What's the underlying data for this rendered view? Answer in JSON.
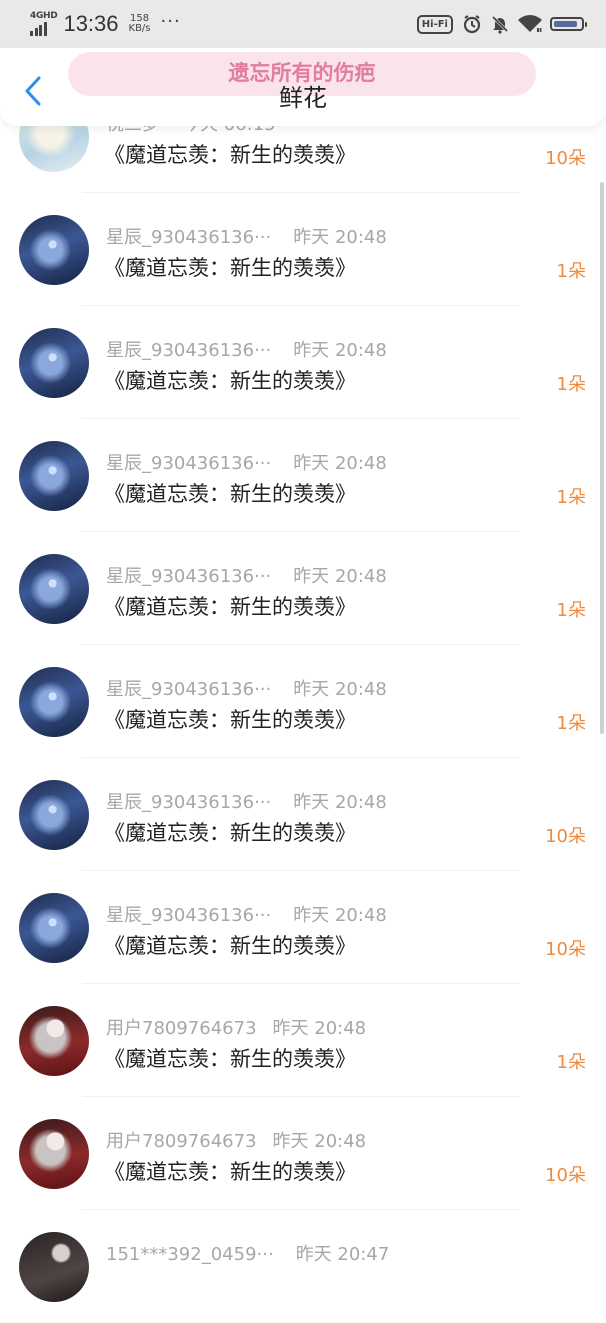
{
  "status_bar": {
    "network": "4GHD",
    "time": "13:36",
    "speed_value": "158",
    "speed_unit": "KB/s",
    "more": "···",
    "hifi": "Hi-Fi",
    "battery_level": 0.9
  },
  "header": {
    "title": "鲜花",
    "back_icon": "chevron-left-icon",
    "banner_text": "遗忘所有的伤疤"
  },
  "colors": {
    "accent_blue": "#2c8ef0",
    "amount_orange": "#f08a3c",
    "banner_pink": "#e27ca0"
  },
  "records": [
    {
      "user": "悦三梦",
      "time": "今天 06:15",
      "book": "《魔道忘羡：新生的羡羡》",
      "amount": "10朵"
    },
    {
      "user": "星辰_930436136···",
      "time": "昨天 20:48",
      "book": "《魔道忘羡：新生的羡羡》",
      "amount": "1朵"
    },
    {
      "user": "星辰_930436136···",
      "time": "昨天 20:48",
      "book": "《魔道忘羡：新生的羡羡》",
      "amount": "1朵"
    },
    {
      "user": "星辰_930436136···",
      "time": "昨天 20:48",
      "book": "《魔道忘羡：新生的羡羡》",
      "amount": "1朵"
    },
    {
      "user": "星辰_930436136···",
      "time": "昨天 20:48",
      "book": "《魔道忘羡：新生的羡羡》",
      "amount": "1朵"
    },
    {
      "user": "星辰_930436136···",
      "time": "昨天 20:48",
      "book": "《魔道忘羡：新生的羡羡》",
      "amount": "1朵"
    },
    {
      "user": "星辰_930436136···",
      "time": "昨天 20:48",
      "book": "《魔道忘羡：新生的羡羡》",
      "amount": "10朵"
    },
    {
      "user": "星辰_930436136···",
      "time": "昨天 20:48",
      "book": "《魔道忘羡：新生的羡羡》",
      "amount": "10朵"
    },
    {
      "user": "用户7809764673",
      "time": "昨天 20:48",
      "book": "《魔道忘羡：新生的羡羡》",
      "amount": "1朵"
    },
    {
      "user": "用户7809764673",
      "time": "昨天 20:48",
      "book": "《魔道忘羡：新生的羡羡》",
      "amount": "10朵"
    },
    {
      "user": "151***392_0459···",
      "time": "昨天 20:47",
      "book": "",
      "amount": ""
    }
  ]
}
